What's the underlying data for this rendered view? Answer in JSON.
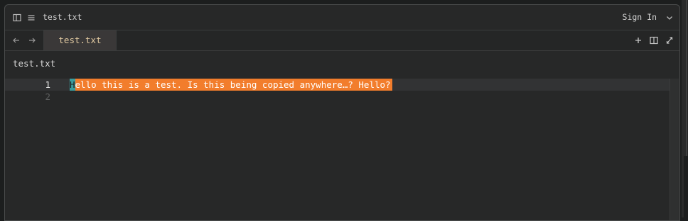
{
  "window": {
    "title": "test.txt",
    "sign_in_label": "Sign In"
  },
  "icons": {
    "sidebar_toggle": "sidebar-icon",
    "menu": "hamburger-icon",
    "account_dropdown": "chevron-down-icon",
    "back": "arrow-left-icon",
    "forward": "arrow-right-icon",
    "new_tab": "plus-icon",
    "split": "split-pane-icon",
    "fullscreen": "expand-icon"
  },
  "tabs": [
    {
      "label": "test.txt",
      "active": true
    }
  ],
  "breadcrumb": "test.txt",
  "editor": {
    "lines": [
      {
        "number": "1",
        "cursor_char": "H",
        "selected_text": "ello this is a test. Is this being copied anywhere…? Hello?"
      },
      {
        "number": "2",
        "text": ""
      }
    ]
  },
  "colors": {
    "selection": "#f27d2c",
    "cursor": "#3a9d9d",
    "background": "#272828",
    "tab_active": "#3a3838"
  }
}
